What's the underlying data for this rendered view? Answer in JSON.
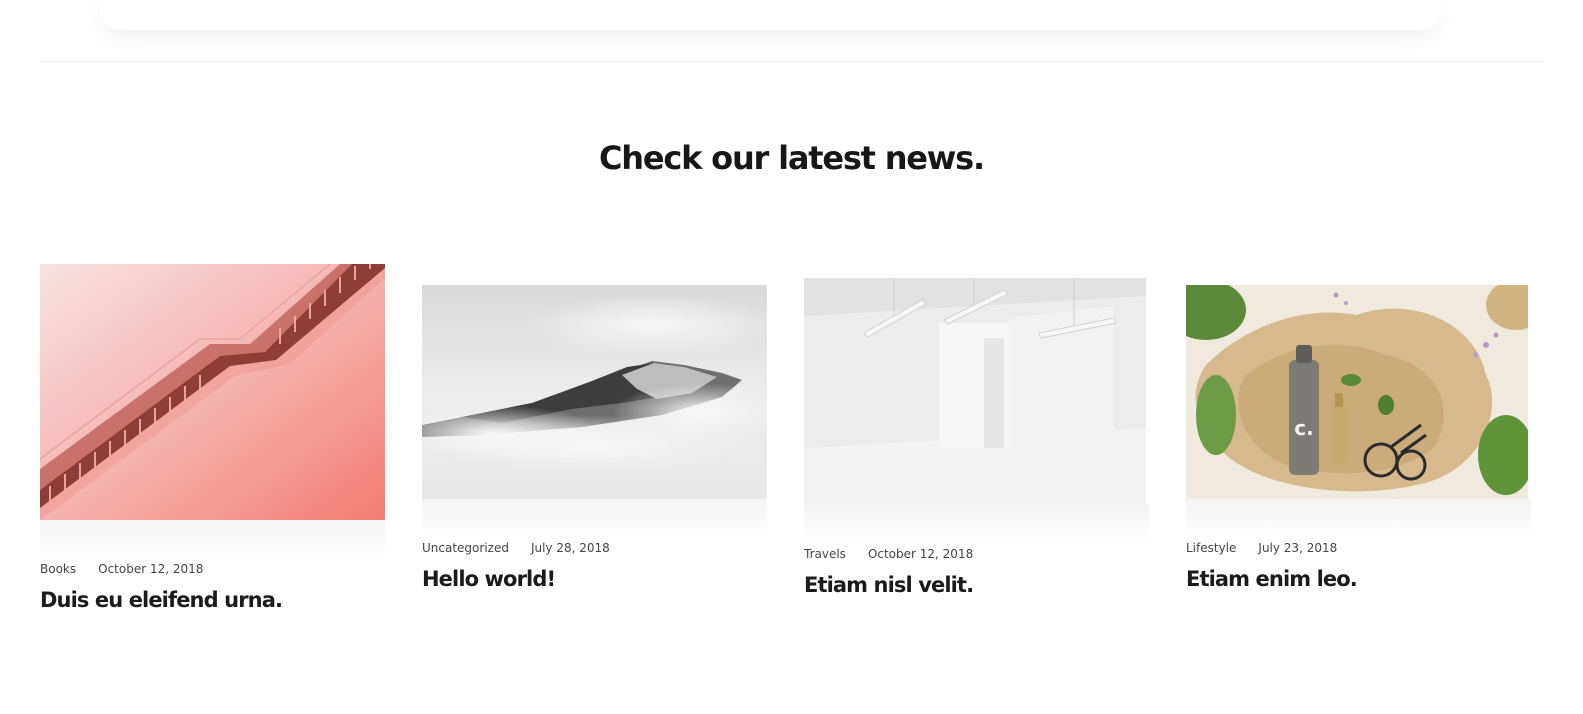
{
  "section": {
    "title": "Check our latest news."
  },
  "posts": [
    {
      "category": "Books",
      "date": "October 12, 2018",
      "title": "Duis eu eleifend urna.",
      "image": "pink-escalator-image"
    },
    {
      "category": "Uncategorized",
      "date": "July 28, 2018",
      "title": "Hello world!",
      "image": "foggy-mountain-image"
    },
    {
      "category": "Travels",
      "date": "October 12, 2018",
      "title": "Etiam nisl velit.",
      "image": "white-room-image"
    },
    {
      "category": "Lifestyle",
      "date": "July 23, 2018",
      "title": "Etiam enim leo.",
      "image": "cosmetic-bottle-image"
    }
  ],
  "colors": {
    "heading": "#171717",
    "meta_text": "#444444",
    "divider": "#efefef"
  }
}
